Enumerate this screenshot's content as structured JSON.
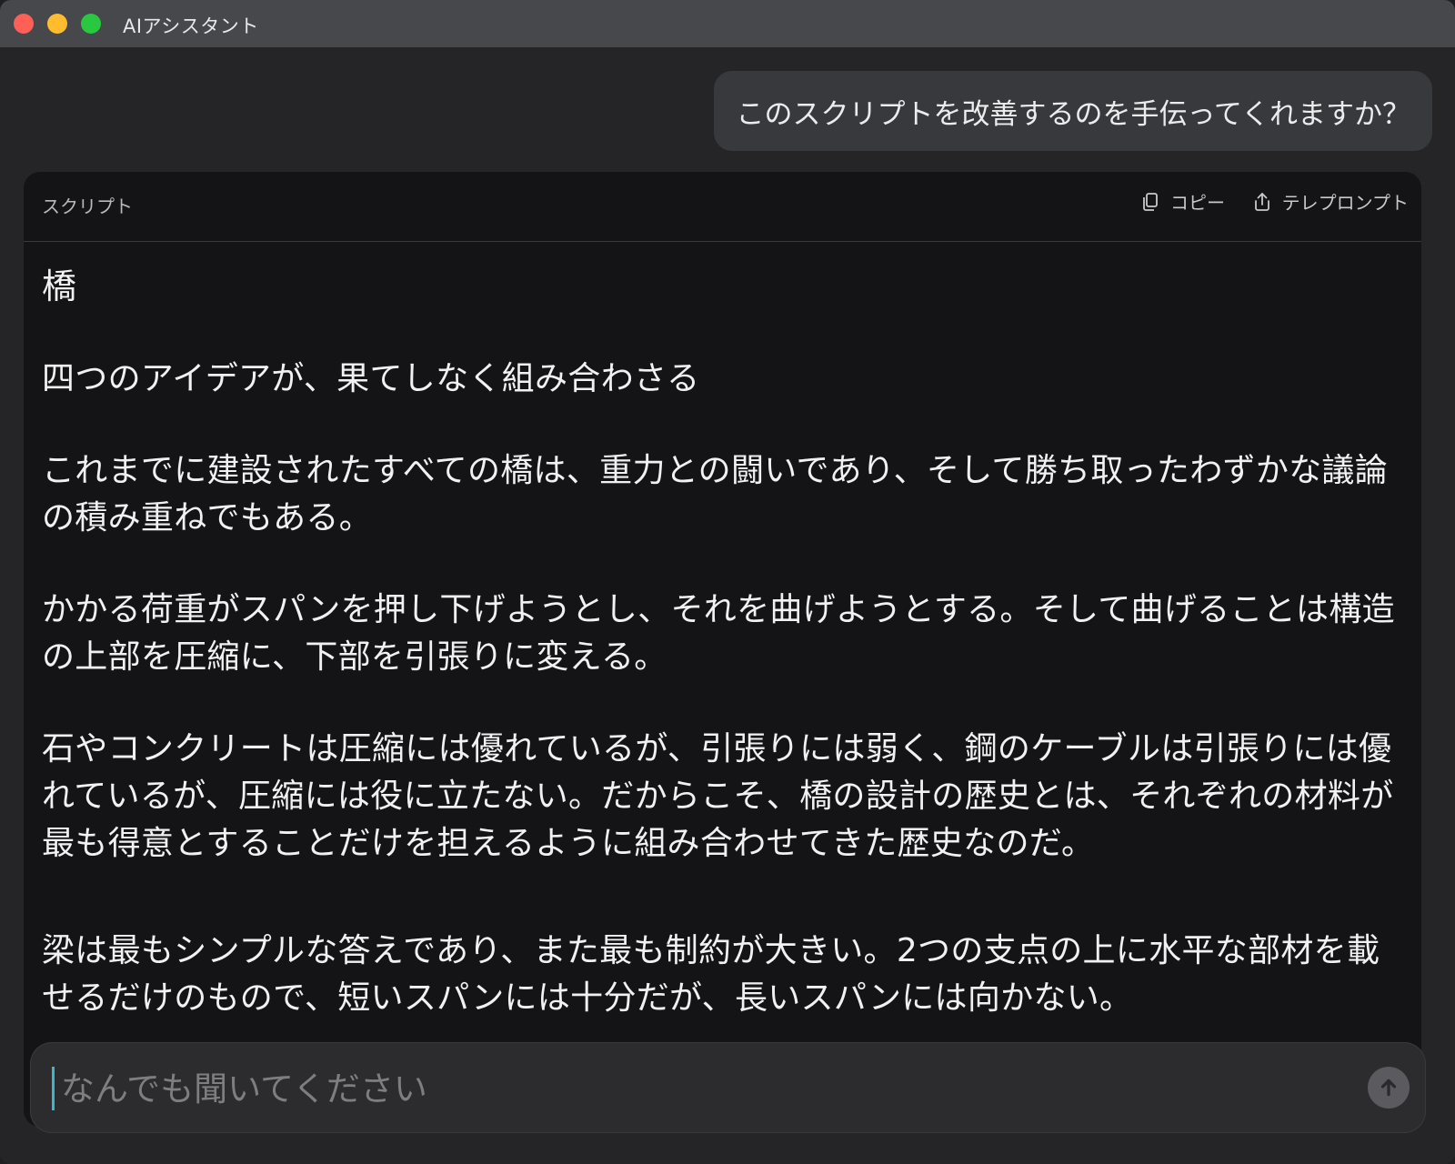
{
  "window": {
    "title": "AIアシスタント"
  },
  "chat": {
    "user_message": "このスクリプトを改善するのを手伝ってくれますか？"
  },
  "script_card": {
    "label": "スクリプト",
    "copy_label": "コピー",
    "teleprompt_label": "テレプロンプト",
    "title": "橋",
    "paragraphs": [
      "四つのアイデアが、果てしなく組み合わさる",
      "これまでに建設されたすべての橋は、重力との闘いであり、そして勝ち取ったわずかな議論の積み重ねでもある。",
      "かかる荷重がスパンを押し下げようとし、それを曲げようとする。そして曲げることは構造の上部を圧縮に、下部を引張りに変える。",
      "石やコンクリートは圧縮には優れているが、引張りには弱く、鋼のケーブルは引張りには優れているが、圧縮には役に立たない。だからこそ、橋の設計の歴史とは、それぞれの材料が最も得意とすることだけを担えるように組み合わせてきた歴史なのだ。",
      "梁は最もシンプルな答えであり、また最も制約が大きい。2つの支点の上に水平な部材を載せるだけのもので、短いスパンには十分だが、長いスパンには向かない。"
    ]
  },
  "composer": {
    "placeholder": "なんでも聞いてください",
    "value": ""
  },
  "icons": {
    "copy": "copy-icon",
    "teleprompt": "share-icon",
    "send": "arrow-up-icon"
  },
  "colors": {
    "close": "#fe5f57",
    "minimize": "#febc2e",
    "maximize": "#28c840",
    "caret": "#3fb6c7"
  }
}
